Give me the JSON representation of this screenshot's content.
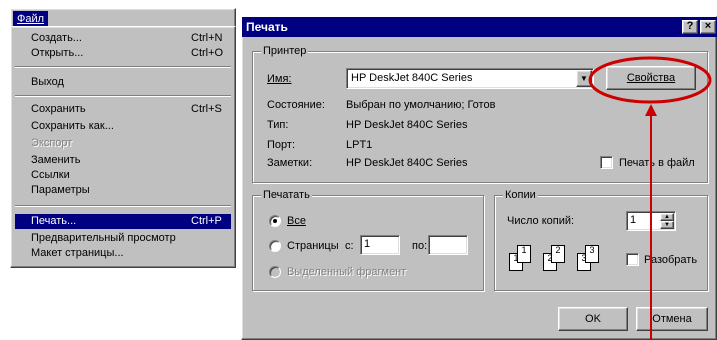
{
  "menu": {
    "title": "Файл",
    "items": {
      "create": "Создать...",
      "create_sc": "Ctrl+N",
      "open": "Открыть...",
      "open_sc": "Ctrl+O",
      "exit": "Выход",
      "save": "Сохранить",
      "save_sc": "Ctrl+S",
      "save_as": "Сохранить как...",
      "export": "Экспорт",
      "replace": "Заменить",
      "links": "Ссылки",
      "params": "Параметры",
      "print": "Печать...",
      "print_sc": "Ctrl+P",
      "preview": "Предварительный просмотр",
      "layout": "Макет страницы..."
    }
  },
  "dialog": {
    "title": "Печать",
    "help_btn": "?",
    "close_btn": "×",
    "printer": {
      "group": "Принтер",
      "name_label": "Имя:",
      "name_value": "HP DeskJet 840C Series",
      "properties": "Свойства",
      "status_label": "Состояние:",
      "status_value": "Выбран по умолчанию; Готов",
      "type_label": "Тип:",
      "type_value": "HP DeskJet 840C Series",
      "port_label": "Порт:",
      "port_value": "LPT1",
      "notes_label": "Заметки:",
      "notes_value": "HP DeskJet 840C Series",
      "print_to_file": "Печать в файл"
    },
    "range": {
      "group": "Печатать",
      "all": "Все",
      "pages": "Страницы",
      "from": "с:",
      "from_value": "1",
      "to": "по:",
      "to_value": "",
      "selection": "Выделенный фрагмент"
    },
    "copies": {
      "group": "Копии",
      "count_label": "Число копий:",
      "count_value": "1",
      "collate": "Разобрать"
    },
    "ok": "OK",
    "cancel": "Отмена"
  },
  "colors": {
    "highlight_circle": "#cc0000",
    "titlebar": "#000080",
    "face": "#c0c0c0"
  }
}
